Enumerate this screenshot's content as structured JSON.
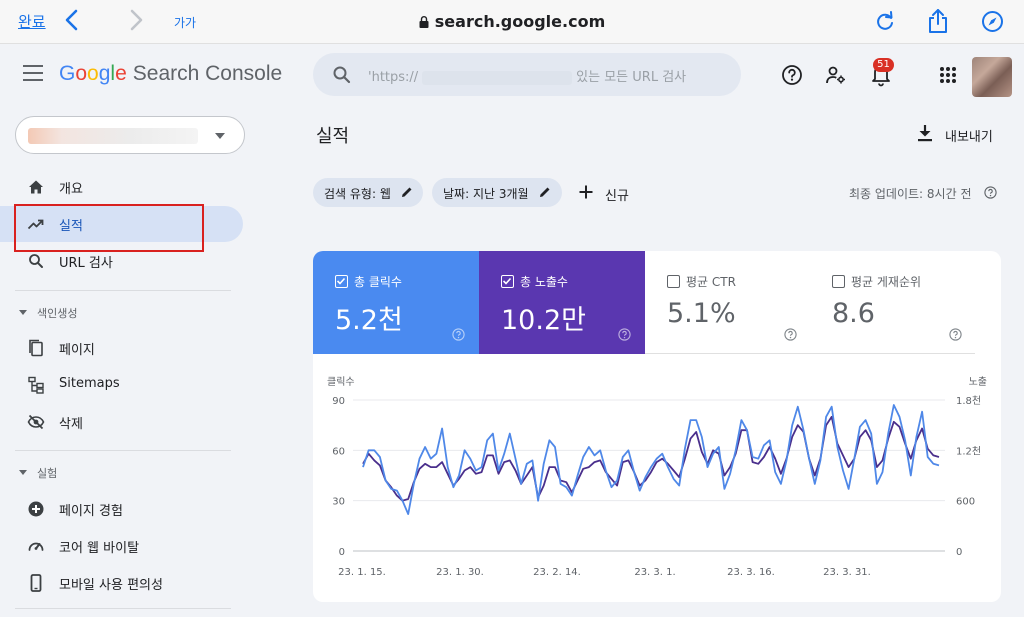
{
  "browser": {
    "done_label": "완료",
    "text_size_label": "가가",
    "url": "search.google.com"
  },
  "header": {
    "logo_text": "Google",
    "product_name": "Search Console",
    "search_placeholder_start": "'https://",
    "search_placeholder_end": "있는 모든 URL 검사",
    "notification_count": "51"
  },
  "sidebar": {
    "items_top": [
      {
        "label": "개요",
        "icon": "home-icon"
      },
      {
        "label": "실적",
        "icon": "trending-up-icon",
        "active": true
      },
      {
        "label": "URL 검사",
        "icon": "search-icon"
      }
    ],
    "section_indexing": "색인생성",
    "items_indexing": [
      {
        "label": "페이지",
        "icon": "pages-icon"
      },
      {
        "label": "Sitemaps",
        "icon": "sitemap-icon"
      },
      {
        "label": "삭제",
        "icon": "visibility-off-icon"
      }
    ],
    "section_experience": "실험",
    "items_experience": [
      {
        "label": "페이지 경험",
        "icon": "plus-circle-icon"
      },
      {
        "label": "코어 웹 바이탈",
        "icon": "speedometer-icon"
      },
      {
        "label": "모바일 사용 편의성",
        "icon": "phone-icon"
      }
    ]
  },
  "main": {
    "page_title": "실적",
    "export_label": "내보내기",
    "filters": [
      {
        "label": "검색 유형: 웹"
      },
      {
        "label": "날짜: 지난 3개월"
      }
    ],
    "add_filter_label": "신규",
    "last_updated": "최종 업데이트: 8시간 전"
  },
  "metrics": [
    {
      "label": "총 클릭수",
      "value": "5.2천",
      "checked": true,
      "color": "#4a8af0"
    },
    {
      "label": "총 노출수",
      "value": "10.2만",
      "checked": true,
      "color": "#5a37b0"
    },
    {
      "label": "평균 CTR",
      "value": "5.1%",
      "checked": false
    },
    {
      "label": "평균 게재순위",
      "value": "8.6",
      "checked": false
    }
  ],
  "chart_data": {
    "type": "line",
    "ylabel_left": "클릭수",
    "ylabel_right": "노출",
    "y_left_ticks": [
      "90",
      "60",
      "30",
      "0"
    ],
    "y_right_ticks": [
      "1.8천",
      "1.2천",
      "600",
      "0"
    ],
    "ylim_left": [
      0,
      90
    ],
    "ylim_right": [
      0,
      1800
    ],
    "x_ticks": [
      "23. 1. 15.",
      "23. 1. 30.",
      "23. 2. 14.",
      "23. 3. 1.",
      "23. 3. 16.",
      "23. 3. 31."
    ],
    "grid": true,
    "series": [
      {
        "name": "총 클릭수",
        "color": "#4f88e8",
        "axis": "left",
        "values": [
          50,
          60,
          60,
          56,
          42,
          37,
          36,
          30,
          22,
          40,
          55,
          62,
          55,
          58,
          73,
          50,
          38,
          45,
          60,
          55,
          48,
          50,
          66,
          70,
          48,
          58,
          70,
          55,
          40,
          52,
          54,
          30,
          52,
          66,
          62,
          40,
          38,
          33,
          45,
          56,
          62,
          57,
          60,
          48,
          38,
          42,
          56,
          60,
          47,
          36,
          44,
          50,
          55,
          58,
          50,
          43,
          39,
          61,
          78,
          78,
          68,
          50,
          58,
          62,
          37,
          46,
          60,
          78,
          72,
          56,
          55,
          63,
          66,
          47,
          40,
          54,
          75,
          86,
          72,
          55,
          40,
          54,
          80,
          86,
          62,
          48,
          37,
          55,
          74,
          78,
          70,
          40,
          47,
          70,
          87,
          80,
          66,
          45,
          68,
          83,
          56,
          52,
          51
        ]
      },
      {
        "name": "총 노출수",
        "color": "#4a2f8c",
        "axis": "right",
        "values": [
          1040,
          1160,
          1080,
          1020,
          840,
          760,
          660,
          600,
          620,
          820,
          980,
          1040,
          1000,
          1000,
          1060,
          920,
          780,
          860,
          960,
          1000,
          920,
          940,
          1140,
          1140,
          920,
          1060,
          1080,
          960,
          800,
          900,
          1000,
          640,
          780,
          1000,
          1000,
          840,
          820,
          700,
          840,
          980,
          1000,
          1060,
          1080,
          940,
          860,
          780,
          1060,
          1080,
          940,
          780,
          840,
          940,
          1060,
          1100,
          1040,
          960,
          880,
          1100,
          1340,
          1420,
          1180,
          1040,
          1200,
          1160,
          900,
          1000,
          1160,
          1440,
          1440,
          1060,
          1040,
          1120,
          1240,
          1100,
          920,
          1100,
          1360,
          1500,
          1420,
          1100,
          900,
          1100,
          1500,
          1600,
          1280,
          1140,
          1000,
          1100,
          1360,
          1440,
          1320,
          1000,
          1080,
          1340,
          1540,
          1480,
          1280,
          1100,
          1320,
          1460,
          1220,
          1140,
          1120
        ]
      }
    ]
  }
}
